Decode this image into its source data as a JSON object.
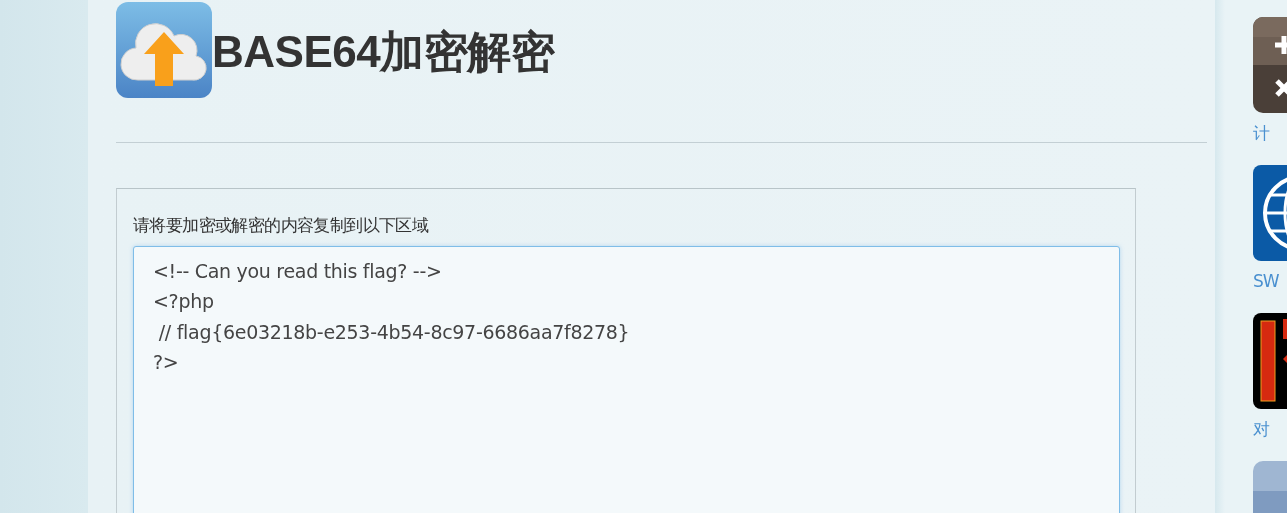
{
  "header": {
    "title": "BASE64加密解密"
  },
  "form": {
    "label": "请将要加密或解密的内容复制到以下区域",
    "value": "<!-- Can you read this flag? -->\n<?php\n // flag{6e03218b-e253-4b54-8c97-6686aa7f8278}\n?>"
  },
  "sidebar": {
    "items": [
      {
        "kind": "calculator",
        "label": "计"
      },
      {
        "kind": "globe",
        "label": "SW"
      },
      {
        "kind": "couplet",
        "label": "对"
      },
      {
        "kind": "text-tile"
      }
    ]
  }
}
